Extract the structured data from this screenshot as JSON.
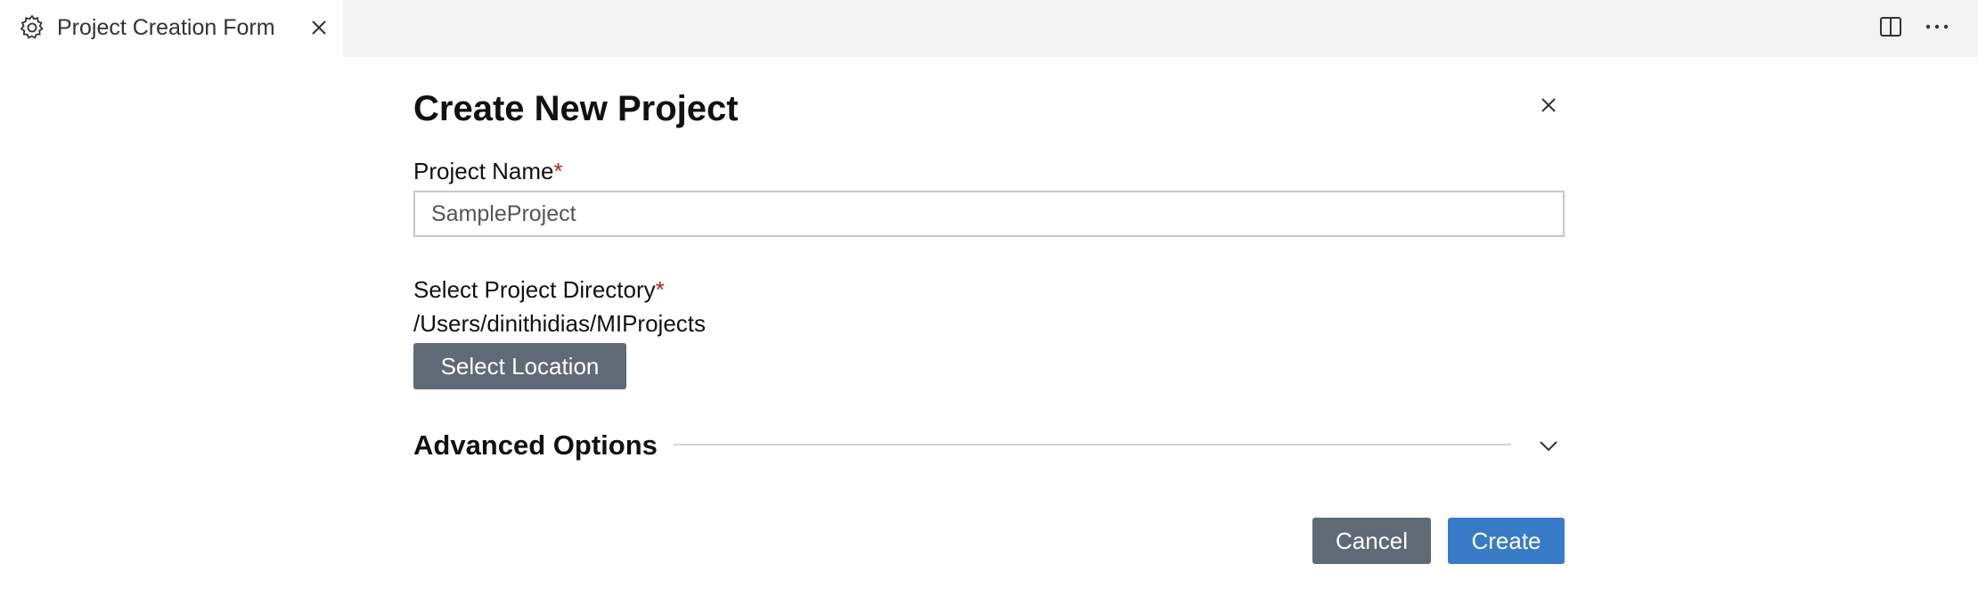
{
  "tab": {
    "title": "Project Creation Form",
    "icon": "gear-icon"
  },
  "toolbar": {
    "split_icon": "split-editor-icon",
    "more_icon": "more-actions-icon"
  },
  "form": {
    "title": "Create New Project",
    "project_name_label": "Project Name",
    "required_marker": "*",
    "project_name_value": "SampleProject",
    "directory_label": "Select Project Directory",
    "directory_path": "/Users/dinithidias/MIProjects",
    "select_location_label": "Select Location",
    "advanced_options_label": "Advanced Options",
    "cancel_label": "Cancel",
    "create_label": "Create"
  },
  "colors": {
    "primary_button": "#3a7bc8",
    "secondary_button": "#5f6a76",
    "required": "#b3261e"
  }
}
